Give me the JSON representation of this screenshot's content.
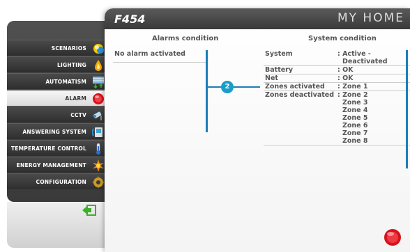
{
  "sidebar": {
    "items": [
      {
        "label": "SCENARIOS",
        "icon": "scenarios-icon"
      },
      {
        "label": "LIGHTING",
        "icon": "lighting-icon"
      },
      {
        "label": "AUTOMATISM",
        "icon": "automatism-icon"
      },
      {
        "label": "ALARM",
        "icon": "alarm-icon"
      },
      {
        "label": "CCTV",
        "icon": "cctv-icon"
      },
      {
        "label": "ANSWERING SYSTEM",
        "icon": "answering-system-icon"
      },
      {
        "label": "TEMPERATURE CONTROL",
        "icon": "thermometer-icon"
      },
      {
        "label": "ENERGY MANAGEMENT",
        "icon": "energy-icon"
      },
      {
        "label": "CONFIGURATION",
        "icon": "gear-icon"
      }
    ]
  },
  "header": {
    "title": "F454",
    "brand": "MY HOME"
  },
  "alarms": {
    "title": "Alarms condition",
    "status": "No alarm activated"
  },
  "system": {
    "title": "System condition",
    "rows": [
      {
        "key": "System",
        "values": [
          ": Active -",
          "Deactivated"
        ]
      },
      {
        "key": "Battery",
        "values": [
          ": OK"
        ]
      },
      {
        "key": "Net",
        "values": [
          ": OK"
        ]
      },
      {
        "key": "Zones activated",
        "values": [
          ": Zone 1"
        ]
      },
      {
        "key": "Zones deactivated",
        "values": [
          ": Zone 2",
          "Zone 3",
          "Zone 4",
          "Zone 5",
          "Zone 6",
          "Zone 7",
          "Zone 8"
        ]
      }
    ]
  },
  "callout": {
    "number": "2"
  },
  "colors": {
    "accent": "#1a7fb8",
    "badge": "#1a9cc9",
    "sidebar_bg": "#3a3a3a",
    "alarm_red": "#d8121b"
  }
}
